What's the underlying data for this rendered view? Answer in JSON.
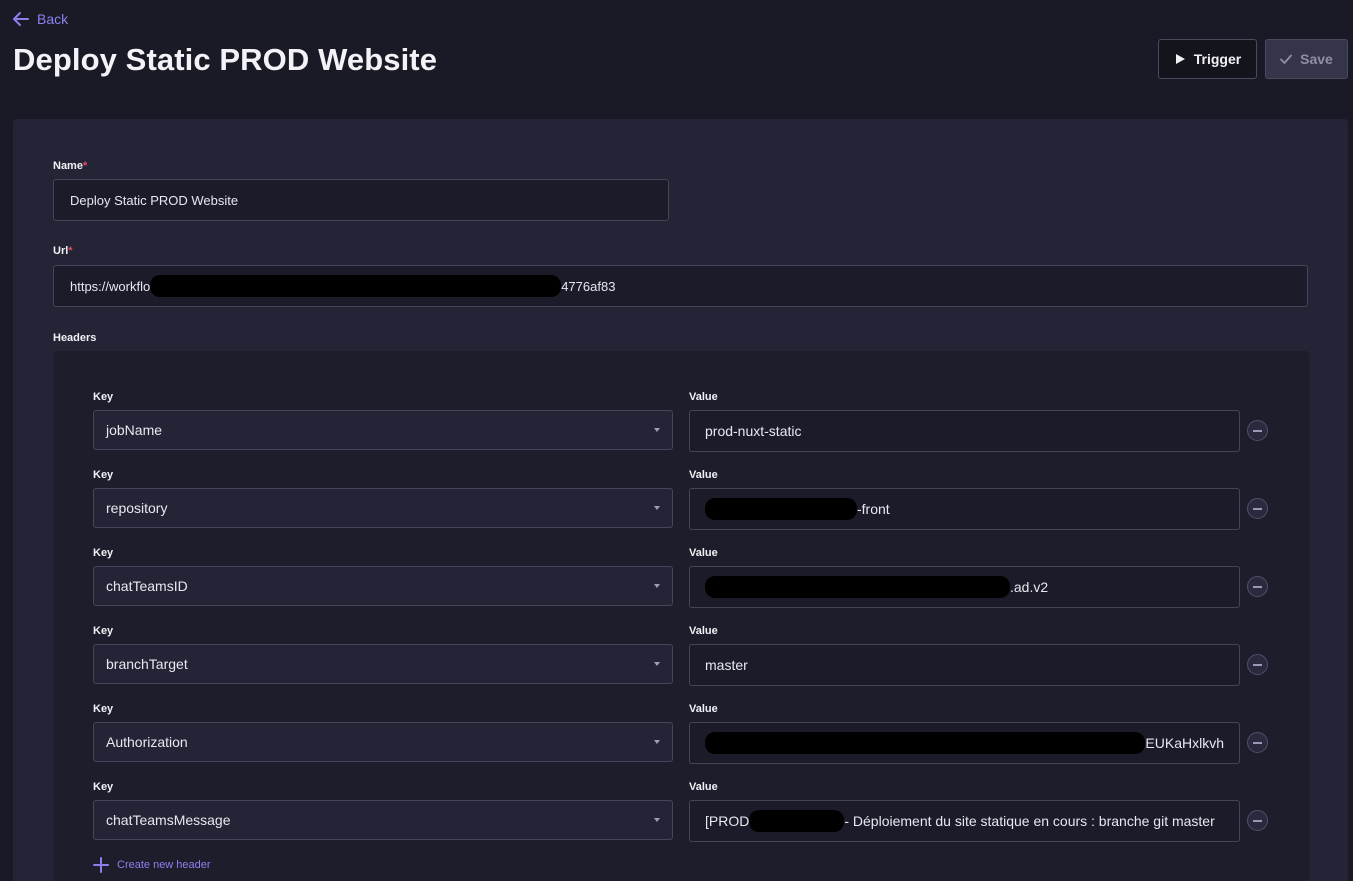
{
  "nav": {
    "back_label": "Back"
  },
  "page": {
    "title": "Deploy Static PROD Website"
  },
  "toolbar": {
    "trigger_label": "Trigger",
    "save_label": "Save"
  },
  "form": {
    "name_label": "Name",
    "name_value": "Deploy Static PROD Website",
    "url_label": "Url",
    "url_prefix": "https://workflo",
    "url_suffix": "4776af83",
    "headers_label": "Headers",
    "required_mark": "*"
  },
  "headers": [
    {
      "key_label": "Key",
      "key": "jobName",
      "value_label": "Value",
      "value_prefix": "prod-nuxt-static",
      "value_suffix": ""
    },
    {
      "key_label": "Key",
      "key": "repository",
      "value_label": "Value",
      "value_prefix": "",
      "value_suffix": "-front"
    },
    {
      "key_label": "Key",
      "key": "chatTeamsID",
      "value_label": "Value",
      "value_prefix": "",
      "value_suffix": ".ad.v2"
    },
    {
      "key_label": "Key",
      "key": "branchTarget",
      "value_label": "Value",
      "value_prefix": "master",
      "value_suffix": ""
    },
    {
      "key_label": "Key",
      "key": "Authorization",
      "value_label": "Value",
      "value_prefix": "",
      "value_suffix": "EUKaHxlkvh"
    },
    {
      "key_label": "Key",
      "key": "chatTeamsMessage",
      "value_label": "Value",
      "value_prefix": "[PROD",
      "value_suffix": "- Déploiement du site statique en cours : branche git master"
    }
  ],
  "actions": {
    "create_header_label": "Create new header"
  },
  "colors": {
    "accent": "#8b80f0",
    "background": "#1a1a27",
    "card": "#242436",
    "required": "#e0505c"
  },
  "icons": {
    "back": "arrow-left-icon",
    "trigger": "play-icon",
    "save": "check-icon",
    "remove": "minus-circle-icon",
    "dropdown": "caret-down-icon",
    "create": "plus-icon"
  }
}
